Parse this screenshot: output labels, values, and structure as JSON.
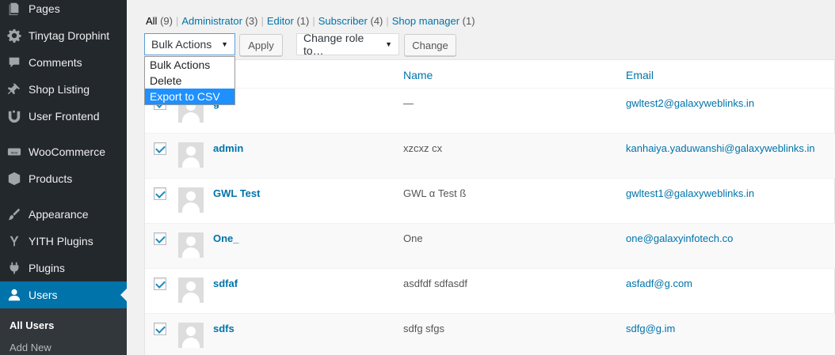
{
  "sidebar": {
    "items": [
      {
        "label": "Pages",
        "icon": "pages-icon"
      },
      {
        "label": "Tinytag Drophint",
        "icon": "gear-icon"
      },
      {
        "label": "Comments",
        "icon": "comment-icon"
      },
      {
        "label": "Shop Listing",
        "icon": "pin-icon"
      },
      {
        "label": "User Frontend",
        "icon": "frontend-icon"
      },
      {
        "label": "WooCommerce",
        "icon": "woocommerce-icon"
      },
      {
        "label": "Products",
        "icon": "box-icon"
      },
      {
        "label": "Appearance",
        "icon": "brush-icon"
      },
      {
        "label": "YITH Plugins",
        "icon": "yith-icon"
      },
      {
        "label": "Plugins",
        "icon": "plug-icon"
      },
      {
        "label": "Users",
        "icon": "user-icon"
      }
    ],
    "submenu": [
      {
        "label": "All Users"
      },
      {
        "label": "Add New"
      }
    ]
  },
  "filters": {
    "all": {
      "label": "All",
      "count": "(9)"
    },
    "administrator": {
      "label": "Administrator",
      "count": "(3)"
    },
    "editor": {
      "label": "Editor",
      "count": "(1)"
    },
    "subscriber": {
      "label": "Subscriber",
      "count": "(4)"
    },
    "shop_manager": {
      "label": "Shop manager",
      "count": "(1)"
    },
    "separator": "|"
  },
  "toolbar": {
    "bulk_actions_value": "Bulk Actions",
    "apply_label": "Apply",
    "change_role_value": "Change role to…",
    "change_label": "Change",
    "dropdown_arrow": "▼"
  },
  "bulk_dropdown": {
    "options": [
      "Bulk Actions",
      "Delete",
      "Export to CSV"
    ],
    "selected": "Export to CSV"
  },
  "table": {
    "columns": {
      "name": "Name",
      "email": "Email"
    },
    "rows": [
      {
        "username": "g",
        "name": "—",
        "email": "gwltest2@galaxyweblinks.in"
      },
      {
        "username": "admin",
        "name": "xzcxz cx",
        "email": "kanhaiya.yaduwanshi@galaxyweblinks.in"
      },
      {
        "username": "GWL Test",
        "name": "GWL α Test ß",
        "email": "gwltest1@galaxyweblinks.in"
      },
      {
        "username": "One_",
        "name": "One",
        "email": "one@galaxyinfotech.co"
      },
      {
        "username": "sdfaf",
        "name": "asdfdf sdfasdf",
        "email": "asfadf@g.com"
      },
      {
        "username": "sdfs",
        "name": "sdfg sfgs",
        "email": "sdfg@g.im"
      }
    ]
  },
  "colors": {
    "sidebar_bg": "#23282d",
    "active_bg": "#0073aa",
    "link": "#0073aa",
    "dropdown_selected": "#1e90ff"
  }
}
